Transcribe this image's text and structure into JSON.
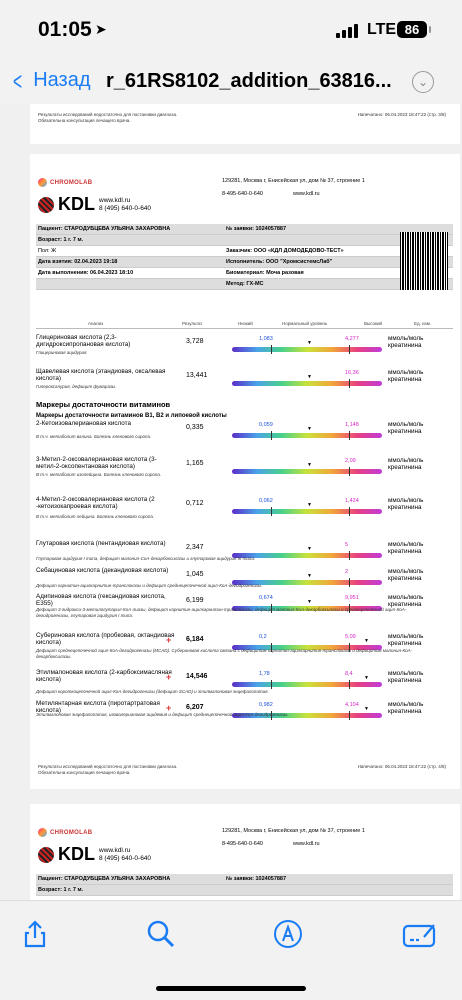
{
  "status": {
    "time": "01:05",
    "network": "LTE",
    "battery": "86"
  },
  "nav": {
    "back": "Назад",
    "title": "r_61RS8102_addition_63816...",
    "more": "⌄"
  },
  "page1_footer": {
    "left1": "Результаты исследований недостаточно для постановки диагноза.",
    "left2": "Обязательна консультация лечащего врача.",
    "right": "Напечатано: 06.04.2023 18:47:22 (стр. 3/8)"
  },
  "header": {
    "chromolab": "CHROMOLAB",
    "kdl": "KDL",
    "site": "www.kdl.ru",
    "phone": "8 (495) 640-0-640",
    "address": "129281, Москва г, Енисейская ул, дом № 37, строение 1",
    "phone2": "8-495-640-0-640",
    "site2": "www.kdl.ru"
  },
  "patient": {
    "name": "Пациент: СТАРОДУБЦЕВА УЛЬЯНА ЗАХАРОВНА",
    "age": "Возраст: 1 г. 7 м.",
    "sex": "Пол: Ж",
    "taken": "Дата взятия: 02.04.2023 19:18",
    "done": "Дата выполнения: 06.04.2023 18:10",
    "order": "№ заявки: 1024057887",
    "customer": "Заказчик: ООО «КДЛ ДОМОДЕДОВО-ТЕСТ»",
    "executor": "Исполнитель: ООО \"ХромсистемсЛаб\"",
    "material": "Биоматериал: Моча разовая",
    "method": "Метод: ГХ-МС"
  },
  "table_head": {
    "analysis": "Анализ",
    "result": "Результат",
    "low": "Низкий",
    "normal": "Нормальный уровень",
    "high": "Высокий",
    "unit": "Ед. изм."
  },
  "section_title": "Маркеры достаточности витаминов",
  "subsection": "Маркеры достаточности витаминов B1, B2 и липоевой кислоты",
  "items": [
    {
      "name": "Глицериновая кислота (2,3-дигидроксипропановая кислота)",
      "value": "3,728",
      "lo": "1,083",
      "hi": "4,277",
      "unit": "ммоль/моль креатинина",
      "note": "Глицериновая ацидурия.",
      "flag": ""
    },
    {
      "name": "Щавелевая кислота (этандиовая, оксалевая кислота)",
      "value": "13,441",
      "lo": "",
      "hi": "16,36",
      "unit": "ммоль/моль креатинина",
      "note": "Гипероксалурия, дефицит фумаразы.",
      "flag": ""
    },
    {
      "name": "2-Кетоизовалериановая кислота",
      "value": "0,335",
      "lo": "0,059",
      "hi": "1,148",
      "unit": "ммоль/моль креатинина",
      "note": "В т.ч. метаболит валина. Болезнь кленового сиропа.",
      "flag": ""
    },
    {
      "name": "3-Метил-2-оксовалериановая кислота (3-метил-2-оксопентановая кислота)",
      "value": "1,165",
      "lo": "",
      "hi": "2,09",
      "unit": "ммоль/моль креатинина",
      "note": "В т.ч. метаболит изолейцина. Болезнь кленового сиропа.",
      "flag": ""
    },
    {
      "name": "4-Метил-2-оксовалериановая кислота (2 -кетоизокапроевая кислота)",
      "value": "0,712",
      "lo": "0,062",
      "hi": "1,424",
      "unit": "ммоль/моль креатинина",
      "note": "В т.ч. метаболит лейцина. Болезнь кленового сиропа.",
      "flag": ""
    },
    {
      "name": "Глутаровая кислота (пентандиовая кислота)",
      "value": "2,347",
      "lo": "",
      "hi": "5",
      "unit": "ммоль/моль креатинина",
      "note": "Глутаровая ацидурия I типа, дефицит малонил-CoA-декарбоксилазы и глутаровая ацидурия III типа.",
      "flag": ""
    },
    {
      "name": "Себациновая кислота (декандиовая кислота)",
      "value": "1,045",
      "lo": "",
      "hi": "2",
      "unit": "ммоль/моль креатинина",
      "note": "Дефицит карнитин-ацилкарнитин-транслоказы и дефицит среднецепочечной ацил-КоА-дегидрогеназы.",
      "flag": ""
    },
    {
      "name": "Адипиновая кислота (гександиовая кислота, E355)",
      "value": "6,199",
      "lo": "0,674",
      "hi": "9,951",
      "unit": "ммоль/моль креатинина",
      "note": "Дефицит 3-гидрокси-3-метилглутарил-КоА-лиазы, дефицит карнитин-ацилкарнитин-транслоказы, дефицит малонил-КоА-декарбоксилазы и среднецепочечной ацил-КоА-дегидрогеназы, глутаровая ацидурия I типа.",
      "flag": ""
    },
    {
      "name": "Субериновая кислота (пробковая, октандиовая кислота)",
      "value": "6,184",
      "lo": "0,2",
      "hi": "5,09",
      "unit": "ммоль/моль креатинина",
      "note": "Дефицит среднецепочечной ацил-КоА-дегидрогеназы (MCAD). Субериновая кислота связана с дефицитом карнитин-ацилкарнитин-транслоказы и дефицитом малонил-КоА-декарбоксилазы.",
      "flag": "+"
    },
    {
      "name": "Этилмалоновая кислота (2-карбоксимасляная кислота)",
      "value": "14,546",
      "lo": "1,78",
      "hi": "8,4",
      "unit": "ммоль/моль креатинина",
      "note": "Дефицит короткоцепочечной ацил-КоА-дегидрогеназы (дефицит SCAD) и этилмалоновая энцефалопатия.",
      "flag": "+"
    },
    {
      "name": "Метилянтарная кислота (пиротартратовая кислота)",
      "value": "6,207",
      "lo": "0,982",
      "hi": "4,104",
      "unit": "ммоль/моль креатинина",
      "note": "Этилмалоновая энцефалопатия, изовалериановая ацидемия и дефицит среднецепочечной ацил-КоА-дегидрогеназы.",
      "flag": "+"
    }
  ],
  "page2_footer": {
    "left1": "Результаты исследований недостаточно для постановки диагноза.",
    "left2": "Обязательна консультация лечащего врача.",
    "right": "Напечатано: 06.04.2023 18:47:22 (стр. 4/8)"
  },
  "page3": {
    "address": "129281, Москва г, Енисейская ул, дом № 37, строение 1",
    "phone2": "8-495-640-0-640",
    "site2": "www.kdl.ru",
    "name": "Пациент: СТАРОДУБЦЕВА УЛЬЯНА ЗАХАРОВНА",
    "order": "№ заявки: 1024057887",
    "age": "Возраст: 1 г. 7 м."
  },
  "toolbar": {
    "share": "share-icon",
    "search": "search-icon",
    "markup": "markup-icon",
    "edit": "edit-icon"
  }
}
